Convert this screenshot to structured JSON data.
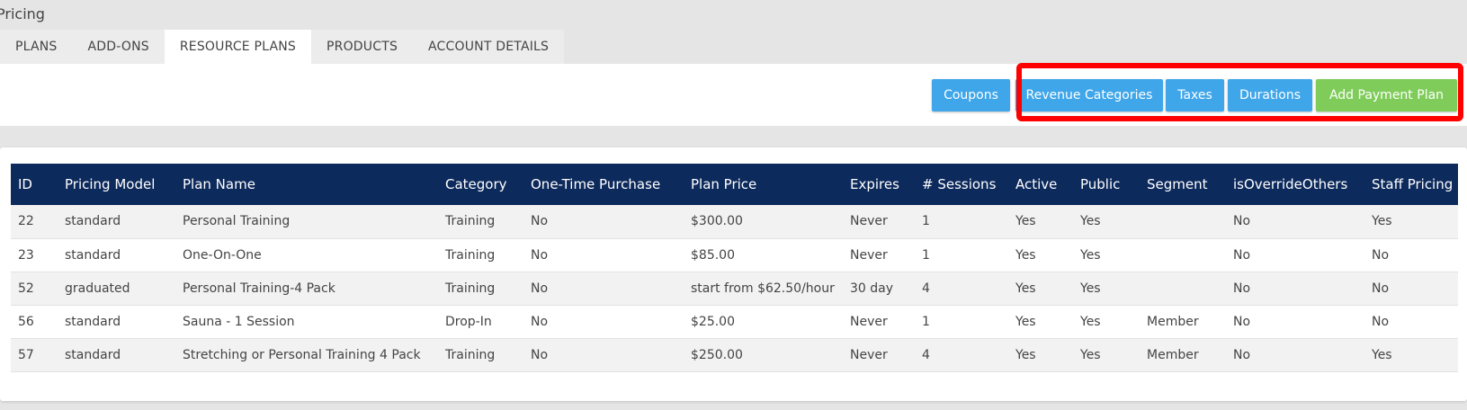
{
  "page": {
    "title": "Pricing"
  },
  "tabs": [
    {
      "label": "PLANS",
      "active": false
    },
    {
      "label": "ADD-ONS",
      "active": false
    },
    {
      "label": "RESOURCE PLANS",
      "active": true
    },
    {
      "label": "PRODUCTS",
      "active": false
    },
    {
      "label": "ACCOUNT DETAILS",
      "active": false
    }
  ],
  "toolbar": {
    "coupons": "Coupons",
    "revenue_categories": "Revenue Categories",
    "taxes": "Taxes",
    "durations": "Durations",
    "add_payment_plan": "Add Payment Plan"
  },
  "colors": {
    "header_navy": "#0d2a5c",
    "button_blue": "#3fa6ea",
    "button_green": "#7fcc5a",
    "highlight_red": "#ff0000"
  },
  "table": {
    "columns": [
      "ID",
      "Pricing Model",
      "Plan Name",
      "Category",
      "One-Time Purchase",
      "Plan Price",
      "Expires",
      "# Sessions",
      "Active",
      "Public",
      "Segment",
      "isOverrideOthers",
      "Staff Pricing"
    ],
    "rows": [
      [
        "22",
        "standard",
        "Personal Training",
        "Training",
        "No",
        "$300.00",
        "Never",
        "1",
        "Yes",
        "Yes",
        "",
        "No",
        "Yes"
      ],
      [
        "23",
        "standard",
        "One-On-One",
        "Training",
        "No",
        "$85.00",
        "Never",
        "1",
        "Yes",
        "Yes",
        "",
        "No",
        "No"
      ],
      [
        "52",
        "graduated",
        "Personal Training-4 Pack",
        "Training",
        "No",
        "start from $62.50/hour",
        "30 day",
        "4",
        "Yes",
        "Yes",
        "",
        "No",
        "No"
      ],
      [
        "56",
        "standard",
        "Sauna - 1 Session",
        "Drop-In",
        "No",
        "$25.00",
        "Never",
        "1",
        "Yes",
        "Yes",
        "Member",
        "No",
        "No"
      ],
      [
        "57",
        "standard",
        "Stretching or Personal Training 4 Pack",
        "Training",
        "No",
        "$250.00",
        "Never",
        "4",
        "Yes",
        "Yes",
        "Member",
        "No",
        "Yes"
      ]
    ]
  }
}
